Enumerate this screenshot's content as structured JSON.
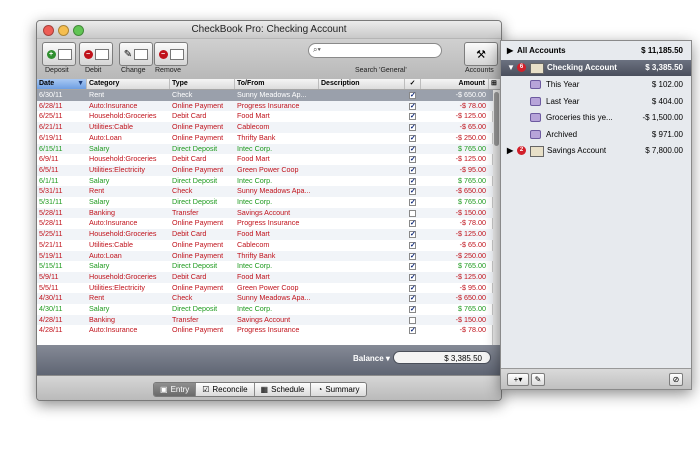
{
  "window": {
    "title": "CheckBook Pro:  Checking Account",
    "toolbar": {
      "deposit": "Deposit",
      "debit": "Debit",
      "change": "Change",
      "remove": "Remove",
      "search_placeholder": "",
      "search_label": "Search 'General'",
      "accounts": "Accounts"
    },
    "columns": {
      "date": "Date",
      "category": "Category",
      "type": "Type",
      "tofrom": "To/From",
      "description": "Description",
      "cleared": "✓",
      "amount": "Amount"
    },
    "colors": {
      "red": "#c0121b",
      "green": "#1d9a1d",
      "selected": "#9aa0ab"
    },
    "rows": [
      {
        "date": "6/30/11",
        "category": "Rent",
        "type": "Check",
        "tofrom": "Sunny Meadows Ap...",
        "checked": true,
        "amount": "-$ 650.00",
        "kind": "selected"
      },
      {
        "date": "6/28/11",
        "category": "Auto:Insurance",
        "type": "Online Payment",
        "tofrom": "Progress Insurance",
        "checked": true,
        "amount": "-$ 78.00",
        "kind": "red"
      },
      {
        "date": "6/25/11",
        "category": "Household:Groceries",
        "type": "Debit Card",
        "tofrom": "Food Mart",
        "checked": true,
        "amount": "-$ 125.00",
        "kind": "red"
      },
      {
        "date": "6/21/11",
        "category": "Utilities:Cable",
        "type": "Online Payment",
        "tofrom": "Cablecom",
        "checked": true,
        "amount": "-$ 65.00",
        "kind": "red"
      },
      {
        "date": "6/19/11",
        "category": "Auto:Loan",
        "type": "Online Payment",
        "tofrom": "Thrifty Bank",
        "checked": true,
        "amount": "-$ 250.00",
        "kind": "red"
      },
      {
        "date": "6/15/11",
        "category": "Salary",
        "type": "Direct Deposit",
        "tofrom": "Intec Corp.",
        "checked": true,
        "amount": "$ 765.00",
        "kind": "green"
      },
      {
        "date": "6/9/11",
        "category": "Household:Groceries",
        "type": "Debit Card",
        "tofrom": "Food Mart",
        "checked": true,
        "amount": "-$ 125.00",
        "kind": "red"
      },
      {
        "date": "6/5/11",
        "category": "Utilities:Electricity",
        "type": "Online Payment",
        "tofrom": "Green Power Coop",
        "checked": true,
        "amount": "-$ 95.00",
        "kind": "red"
      },
      {
        "date": "6/1/11",
        "category": "Salary",
        "type": "Direct Deposit",
        "tofrom": "Intec Corp.",
        "checked": true,
        "amount": "$ 765.00",
        "kind": "green"
      },
      {
        "date": "5/31/11",
        "category": "Rent",
        "type": "Check",
        "tofrom": "Sunny Meadows Apa...",
        "checked": true,
        "amount": "-$ 650.00",
        "kind": "red"
      },
      {
        "date": "5/31/11",
        "category": "Salary",
        "type": "Direct Deposit",
        "tofrom": "Intec Corp.",
        "checked": true,
        "amount": "$ 765.00",
        "kind": "green"
      },
      {
        "date": "5/28/11",
        "category": "Banking",
        "type": "Transfer",
        "tofrom": "Savings Account",
        "checked": false,
        "amount": "-$ 150.00",
        "kind": "red"
      },
      {
        "date": "5/28/11",
        "category": "Auto:Insurance",
        "type": "Online Payment",
        "tofrom": "Progress Insurance",
        "checked": true,
        "amount": "-$ 78.00",
        "kind": "red"
      },
      {
        "date": "5/25/11",
        "category": "Household:Groceries",
        "type": "Debit Card",
        "tofrom": "Food Mart",
        "checked": true,
        "amount": "-$ 125.00",
        "kind": "red"
      },
      {
        "date": "5/21/11",
        "category": "Utilities:Cable",
        "type": "Online Payment",
        "tofrom": "Cablecom",
        "checked": true,
        "amount": "-$ 65.00",
        "kind": "red"
      },
      {
        "date": "5/19/11",
        "category": "Auto:Loan",
        "type": "Online Payment",
        "tofrom": "Thrifty Bank",
        "checked": true,
        "amount": "-$ 250.00",
        "kind": "red"
      },
      {
        "date": "5/15/11",
        "category": "Salary",
        "type": "Direct Deposit",
        "tofrom": "Intec Corp.",
        "checked": true,
        "amount": "$ 765.00",
        "kind": "green"
      },
      {
        "date": "5/9/11",
        "category": "Household:Groceries",
        "type": "Debit Card",
        "tofrom": "Food Mart",
        "checked": true,
        "amount": "-$ 125.00",
        "kind": "red"
      },
      {
        "date": "5/5/11",
        "category": "Utilities:Electricity",
        "type": "Online Payment",
        "tofrom": "Green Power Coop",
        "checked": true,
        "amount": "-$ 95.00",
        "kind": "red"
      },
      {
        "date": "4/30/11",
        "category": "Rent",
        "type": "Check",
        "tofrom": "Sunny Meadows Apa...",
        "checked": true,
        "amount": "-$ 650.00",
        "kind": "red"
      },
      {
        "date": "4/30/11",
        "category": "Salary",
        "type": "Direct Deposit",
        "tofrom": "Intec Corp.",
        "checked": true,
        "amount": "$ 765.00",
        "kind": "green"
      },
      {
        "date": "4/28/11",
        "category": "Banking",
        "type": "Transfer",
        "tofrom": "Savings Account",
        "checked": false,
        "amount": "-$ 150.00",
        "kind": "red"
      },
      {
        "date": "4/28/11",
        "category": "Auto:Insurance",
        "type": "Online Payment",
        "tofrom": "Progress Insurance",
        "checked": true,
        "amount": "-$ 78.00",
        "kind": "red"
      }
    ],
    "balance": {
      "label": "Balance ▾",
      "value": "$ 3,385.50"
    },
    "tabs": [
      {
        "label": "Entry",
        "selected": true
      },
      {
        "label": "Reconcile",
        "selected": false
      },
      {
        "label": "Schedule",
        "selected": false
      },
      {
        "label": "Summary",
        "selected": false
      }
    ]
  },
  "sidebar": {
    "all_accounts": {
      "label": "All Accounts",
      "value": "$ 11,185.50"
    },
    "checking": {
      "label": "Checking Account",
      "value": "$ 3,385.50",
      "badge": "6"
    },
    "folders": [
      {
        "label": "This Year",
        "value": "$ 102.00"
      },
      {
        "label": "Last Year",
        "value": "$ 404.00"
      },
      {
        "label": "Groceries this ye...",
        "value": "-$ 1,500.00"
      },
      {
        "label": "Archived",
        "value": "$ 971.00"
      }
    ],
    "savings": {
      "label": "Savings Account",
      "value": "$ 7,800.00",
      "badge": "2"
    }
  }
}
